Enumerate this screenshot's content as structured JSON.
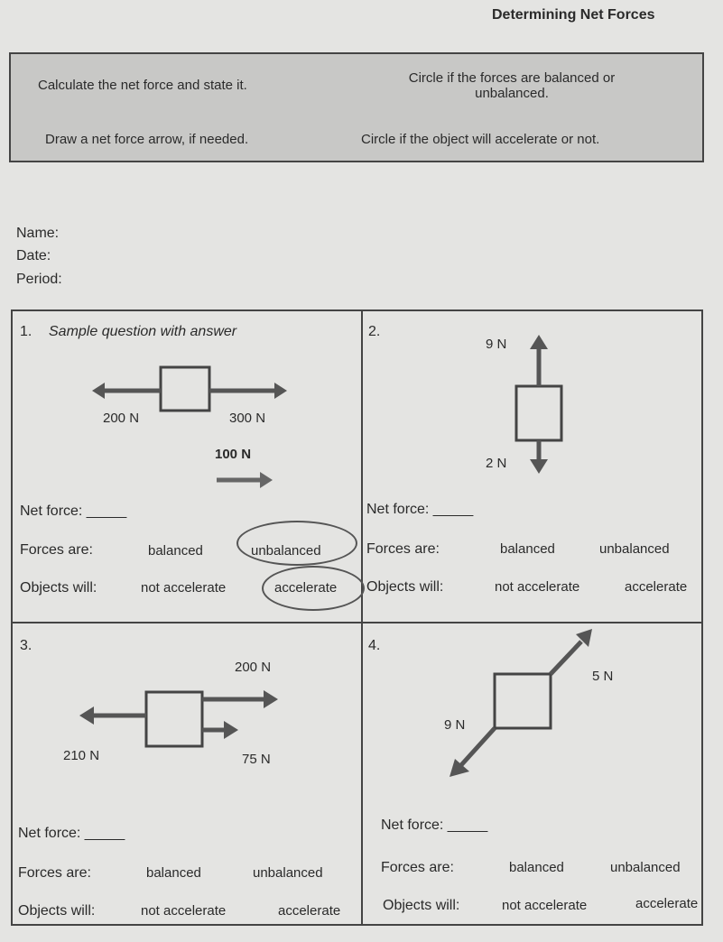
{
  "title": "Determining Net Forces",
  "instructions": {
    "calc": "Calculate the net force and state it.",
    "circle_balanced": "Circle if the forces are balanced or unbalanced.",
    "draw": "Draw a net force arrow, if needed.",
    "circle_accel": "Circle if the object will accelerate or not."
  },
  "fields": {
    "name": "Name:",
    "date": "Date:",
    "period": "Period:"
  },
  "labels": {
    "net_force": "Net force: _____",
    "forces_are": "Forces are:",
    "objects_will": "Objects will:",
    "balanced": "balanced",
    "unbalanced": "unbalanced",
    "not_accelerate": "not accelerate",
    "accelerate": "accelerate"
  },
  "questions": [
    {
      "number": "1.",
      "heading": "Sample question with answer",
      "forces": [
        "200 N",
        "300 N"
      ],
      "answer": "100 N",
      "circled": [
        "unbalanced",
        "accelerate"
      ]
    },
    {
      "number": "2.",
      "forces": [
        "9 N",
        "2 N"
      ]
    },
    {
      "number": "3.",
      "forces": [
        "200 N",
        "210 N",
        "75 N"
      ]
    },
    {
      "number": "4.",
      "forces": [
        "5 N",
        "9 N"
      ]
    }
  ],
  "colors": {
    "header_bg": "#c8c8c6",
    "arrow": "#555555",
    "paper": "#e4e4e2"
  }
}
